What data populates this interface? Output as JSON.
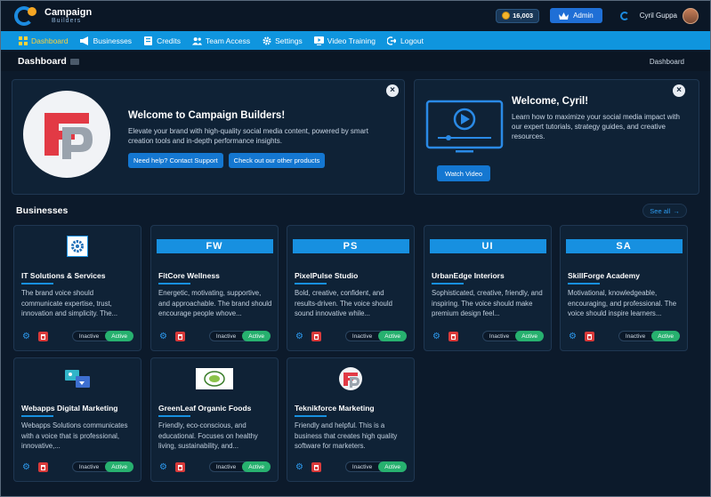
{
  "header": {
    "logo_line1": "Campaign",
    "logo_line2": "Builders",
    "credits": "16,003",
    "admin_label": "Admin",
    "user_name": "Cyril Guppa"
  },
  "nav": [
    {
      "label": "Dashboard",
      "icon": "dashboard-icon",
      "active": true
    },
    {
      "label": "Businesses",
      "icon": "megaphone-icon"
    },
    {
      "label": "Credits",
      "icon": "credits-icon"
    },
    {
      "label": "Team Access",
      "icon": "team-icon"
    },
    {
      "label": "Settings",
      "icon": "gear-icon"
    },
    {
      "label": "Video Training",
      "icon": "video-icon"
    },
    {
      "label": "Logout",
      "icon": "logout-icon"
    }
  ],
  "breadcrumb": {
    "title": "Dashboard",
    "current": "Dashboard"
  },
  "welcome": {
    "title": "Welcome to Campaign Builders!",
    "text": "Elevate your brand with high-quality social media content, powered by smart creation tools and in-depth performance insights.",
    "support_btn": "Need help? Contact Support",
    "products_btn": "Check out our other products"
  },
  "video_banner": {
    "title": "Welcome, Cyril!",
    "text": "Learn how to maximize your social media impact with our expert tutorials, strategy guides, and creative resources.",
    "watch_btn": "Watch Video"
  },
  "close_symbol": "×",
  "businesses": {
    "title": "Businesses",
    "see_all": "See all",
    "arrow": "→",
    "inactive_label": "Inactive",
    "active_label": "Active",
    "items": [
      {
        "name": "IT Solutions & Services",
        "desc": "The brand voice should communicate expertise, trust, innovation and simplicity. The...",
        "logo": "gear-logo"
      },
      {
        "name": "FitCore Wellness",
        "desc": "Energetic, motivating, supportive, and approachable. The brand should encourage people whove...",
        "abbr": "FW"
      },
      {
        "name": "PixelPulse Studio",
        "desc": "Bold, creative, confident, and results-driven. The voice should sound innovative while...",
        "abbr": "PS"
      },
      {
        "name": "UrbanEdge Interiors",
        "desc": "Sophisticated, creative, friendly, and inspiring. The voice should make premium design feel...",
        "abbr": "UI"
      },
      {
        "name": "SkillForge Academy",
        "desc": "Motivational, knowledgeable, encouraging, and professional. The voice should inspire learners...",
        "abbr": "SA"
      },
      {
        "name": "Webapps Digital Marketing",
        "desc": "Webapps Solutions communicates with a voice that is professional, innovative,...",
        "logo": "webapps-logo"
      },
      {
        "name": "GreenLeaf Organic Foods",
        "desc": "Friendly, eco-conscious, and educational. Focuses on healthy living, sustainability, and...",
        "logo": "greenleaf-logo"
      },
      {
        "name": "Teknikforce Marketing",
        "desc": "Friendly and helpful. This is a business that creates high quality software for marketers.",
        "logo": "teknikforce-logo"
      }
    ]
  },
  "colors": {
    "accent": "#0f95de",
    "active_nav": "#ffd23b",
    "active_toggle": "#27b16f",
    "delete": "#d93a3a"
  }
}
